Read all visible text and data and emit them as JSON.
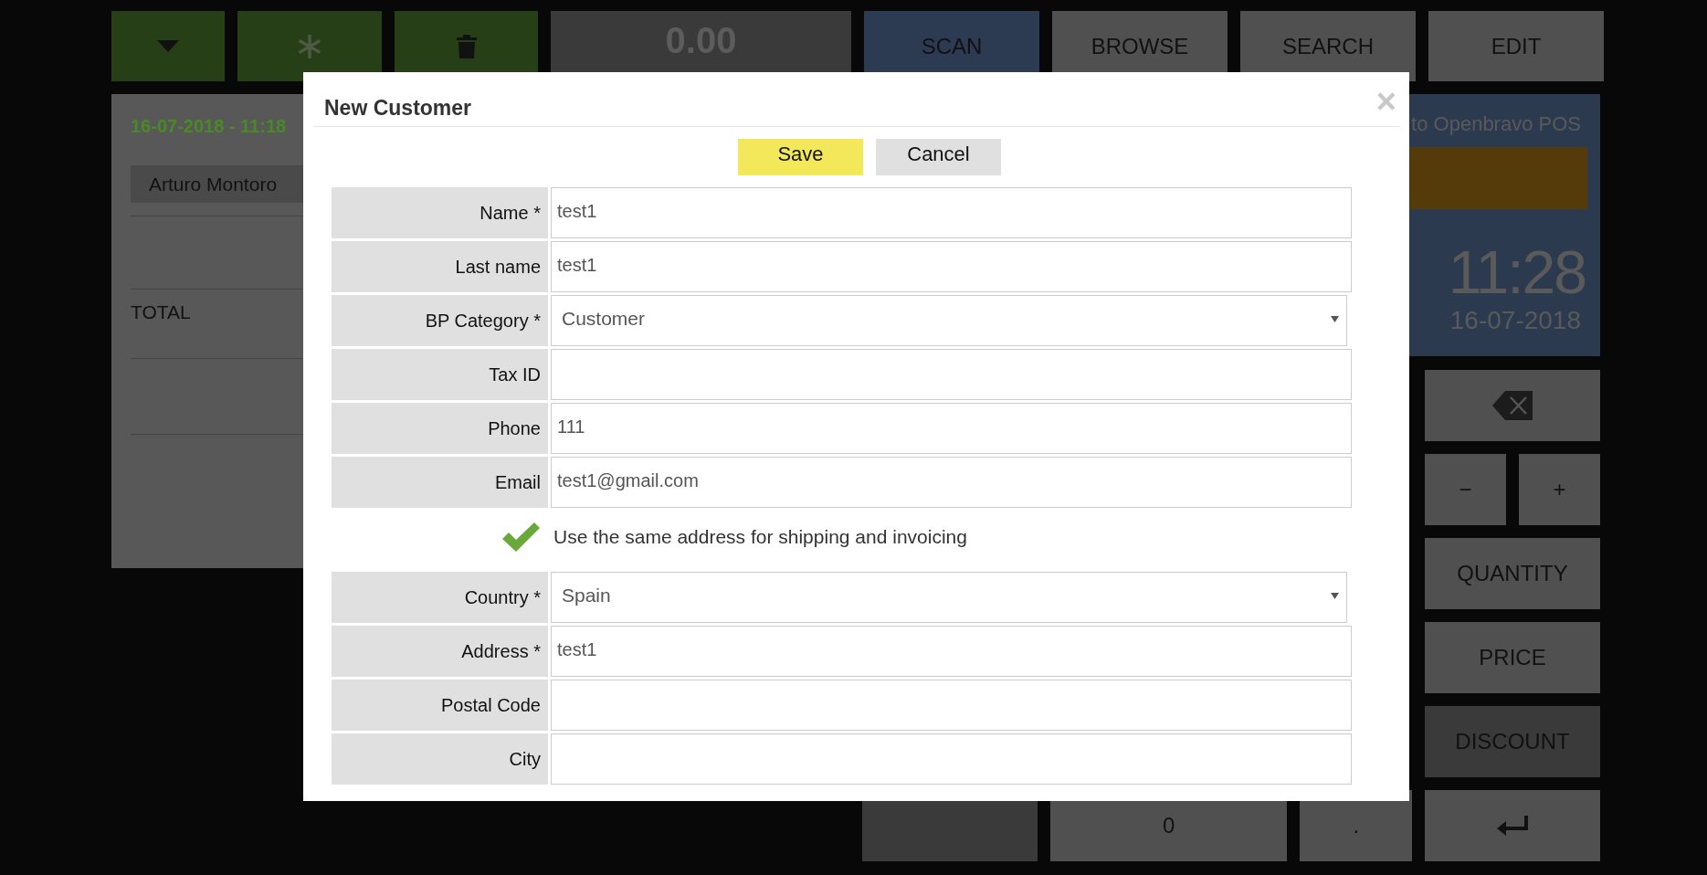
{
  "toolbar": {
    "display": "0.00",
    "buttons": [
      {
        "label": "SCAN",
        "selected": true
      },
      {
        "label": "BROWSE",
        "selected": false
      },
      {
        "label": "SEARCH",
        "selected": false
      },
      {
        "label": "EDIT",
        "selected": false
      }
    ]
  },
  "ticket": {
    "date": "16-07-2018 - 11:18",
    "customer": "Arturo Montoro",
    "total_label": "TOTAL"
  },
  "welcome": {
    "text": "to Openbravo POS",
    "time": "11:28",
    "date": "16-07-2018"
  },
  "keypad": [
    [
      {
        "kind": "backspace",
        "selected": false
      }
    ],
    [
      {
        "kind": "text",
        "label": "−",
        "selected": false
      },
      {
        "kind": "text",
        "label": "+",
        "selected": false
      }
    ],
    [
      {
        "kind": "text",
        "label": "QUANTITY",
        "selected": false
      }
    ],
    [
      {
        "kind": "text",
        "label": "PRICE",
        "selected": false
      }
    ],
    [
      {
        "kind": "text",
        "label": "DISCOUNT",
        "selected": true
      }
    ],
    [
      {
        "kind": "blank",
        "selected": true
      },
      {
        "kind": "text",
        "label": "0",
        "selected": false
      },
      {
        "kind": "text",
        "label": ".",
        "selected": false
      },
      {
        "kind": "enter",
        "selected": false
      }
    ]
  ],
  "dialog": {
    "title": "New Customer",
    "close": "×",
    "buttons": [
      {
        "label": "Save",
        "kind": "primary"
      },
      {
        "label": "Cancel",
        "kind": "secondary"
      }
    ],
    "fields": [
      {
        "kind": "text",
        "label": "Name *",
        "value": "test1"
      },
      {
        "kind": "text",
        "label": "Last name",
        "value": "test1"
      },
      {
        "kind": "select",
        "label": "BP Category *",
        "value": "Customer"
      },
      {
        "kind": "text",
        "label": "Tax ID"
      },
      {
        "kind": "text",
        "label": "Phone",
        "value": "111"
      },
      {
        "kind": "text",
        "label": "Email",
        "value": "test1@gmail.com"
      },
      {
        "kind": "checkbox",
        "label": "Use the same address for shipping and invoicing",
        "checked": true
      },
      {
        "kind": "select",
        "label": "Country *",
        "value": "Spain"
      },
      {
        "kind": "text",
        "label": "Address *",
        "value": "test1"
      },
      {
        "kind": "text",
        "label": "Postal Code"
      },
      {
        "kind": "text",
        "label": "City"
      }
    ]
  }
}
